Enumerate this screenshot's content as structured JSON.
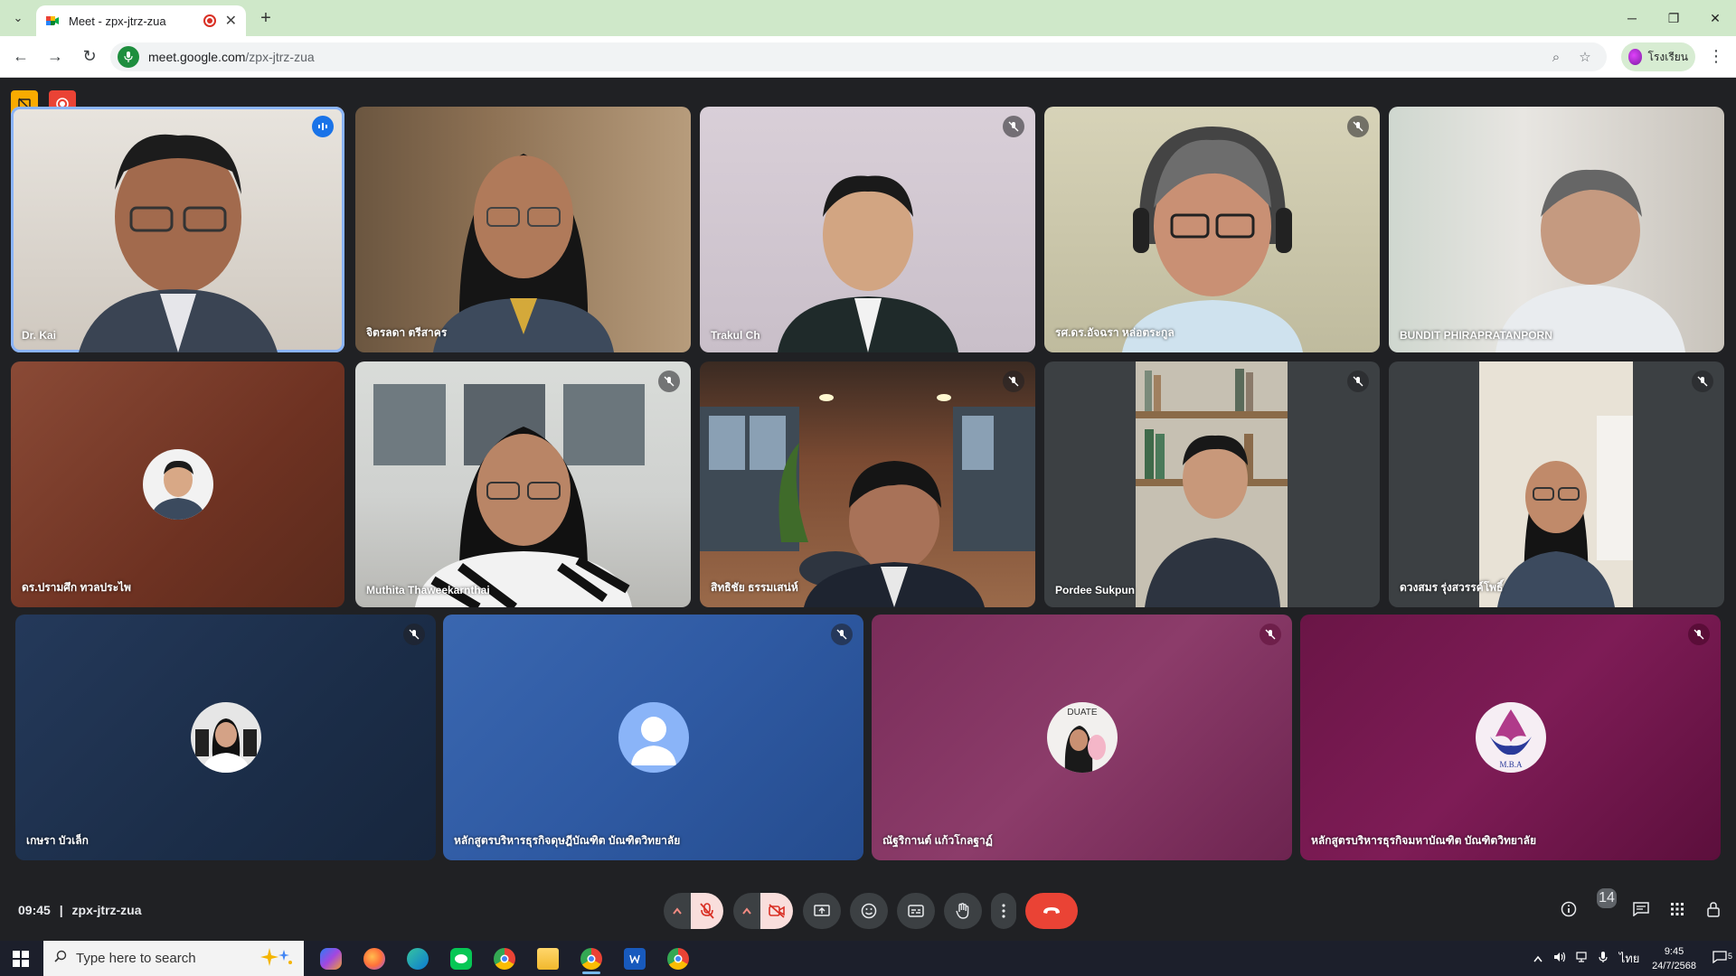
{
  "browser": {
    "tab_title": "Meet - zpx-jtrz-zua",
    "url_host": "meet.google.com",
    "url_path": "/zpx-jtrz-zua",
    "profile_label": "โรงเรียน",
    "menu_glyph": "⌄",
    "newtab_glyph": "+",
    "close_glyph": "✕",
    "back_glyph": "←",
    "forward_glyph": "→",
    "reload_glyph": "↻",
    "zoom_glyph": "⌕",
    "star_glyph": "☆",
    "kebab_glyph": "⋮",
    "minimize_glyph": "─",
    "restore_glyph": "❐",
    "window_close_glyph": "✕"
  },
  "meet": {
    "participants": [
      {
        "name": "Dr. Kai",
        "mic": "speaking",
        "active": true
      },
      {
        "name": "จิตรลดา ตรีสาคร",
        "mic": "none"
      },
      {
        "name": "Trakul Ch",
        "mic": "muted"
      },
      {
        "name": "รศ.ดร.อัจฉรา หล่อตระกูล",
        "mic": "muted"
      },
      {
        "name": "BUNDIT PHIRAPRATANPORN",
        "mic": "none"
      },
      {
        "name": "ดร.ปรามศึก ทวลประไพ",
        "mic": "none"
      },
      {
        "name": "Muthita Thaweekarnthai",
        "mic": "muted"
      },
      {
        "name": "สิทธิชัย ธรรมเสน่ห์",
        "mic": "muted"
      },
      {
        "name": "Pordee Sukpun",
        "mic": "muted"
      },
      {
        "name": "ดวงสมร รุ่งสวรรค์โพธิ์",
        "mic": "muted"
      },
      {
        "name": "เกษรา บัวเล็ก",
        "mic": "muted"
      },
      {
        "name": "หลักสูตรบริหารธุรกิจดุษฎีบัณฑิต บัณฑิตวิทยาลัย",
        "mic": "muted"
      },
      {
        "name": "ณัฐริกานต์ แก้วโกลฐาฏ์",
        "mic": "muted"
      },
      {
        "name": "หลักสูตรบริหารธุรกิจมหาบัณฑิต บัณฑิตวิทยาลัย",
        "mic": "muted"
      }
    ],
    "logo_text": "M.B.A",
    "graduate_text": "DUATE"
  },
  "controls": {
    "time": "09:45",
    "separator": "|",
    "meeting_code": "zpx-jtrz-zua",
    "participants_count": "14"
  },
  "taskbar": {
    "search_placeholder": "Type here to search",
    "ime_label": "ไทย",
    "clock_time": "9:45",
    "clock_date": "24/7/2568",
    "notif_count": "5",
    "apps": [
      "copilot",
      "firefox",
      "edge",
      "line",
      "chrome",
      "file-explorer",
      "chrome",
      "word",
      "chrome"
    ]
  },
  "colors": {
    "accent": "#8ab4f8",
    "end_call": "#ea4335",
    "meet_bg": "#202124",
    "tabstrip": "#cfe8c9"
  }
}
